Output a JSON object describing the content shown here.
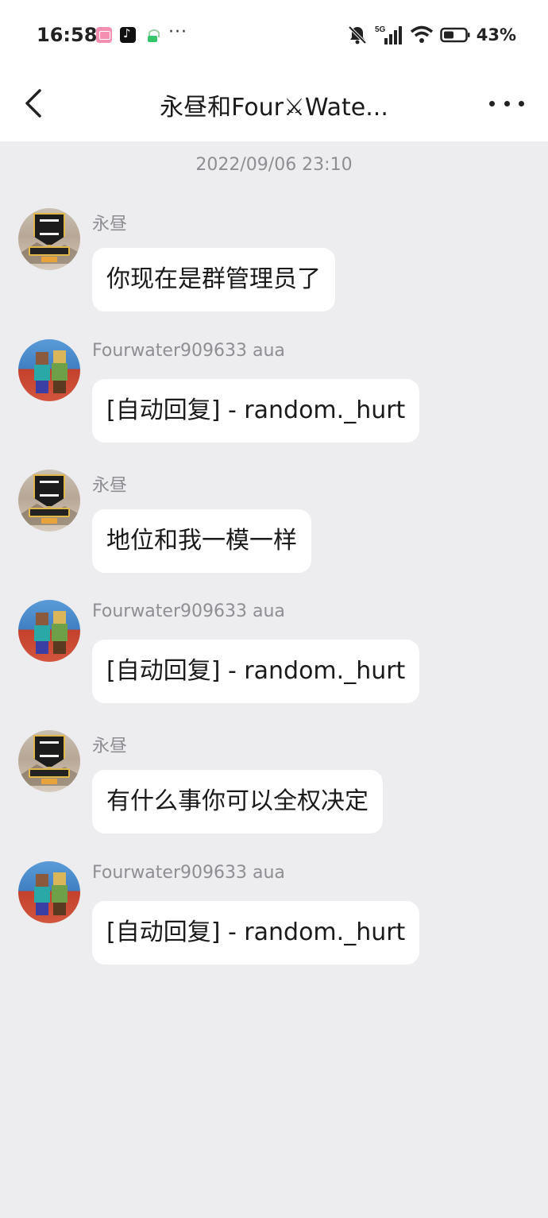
{
  "status_bar": {
    "time": "16:58",
    "network": "5G",
    "battery": "43%"
  },
  "header": {
    "title": "永昼和Four⚔Wate..."
  },
  "chat": {
    "timestamp": "2022/09/06 23:10",
    "messages": [
      {
        "sender": "永昼",
        "text": "你现在是群管理员了",
        "avatar": "badge-avatar"
      },
      {
        "sender": "Fourwater909633 aua",
        "text": "[自动回复] - random._hurt",
        "avatar": "minecraft-avatar"
      },
      {
        "sender": "永昼",
        "text": "地位和我一模一样",
        "avatar": "badge-avatar"
      },
      {
        "sender": "Fourwater909633 aua",
        "text": "[自动回复] - random._hurt",
        "avatar": "minecraft-avatar"
      },
      {
        "sender": "永昼",
        "text": "有什么事你可以全权决定",
        "avatar": "badge-avatar"
      },
      {
        "sender": "Fourwater909633 aua",
        "text": "[自动回复] - random._hurt",
        "avatar": "minecraft-avatar"
      }
    ]
  },
  "colors": {
    "background": "#ededf0",
    "bubble": "#ffffff",
    "meta_text": "#8e8e93"
  }
}
